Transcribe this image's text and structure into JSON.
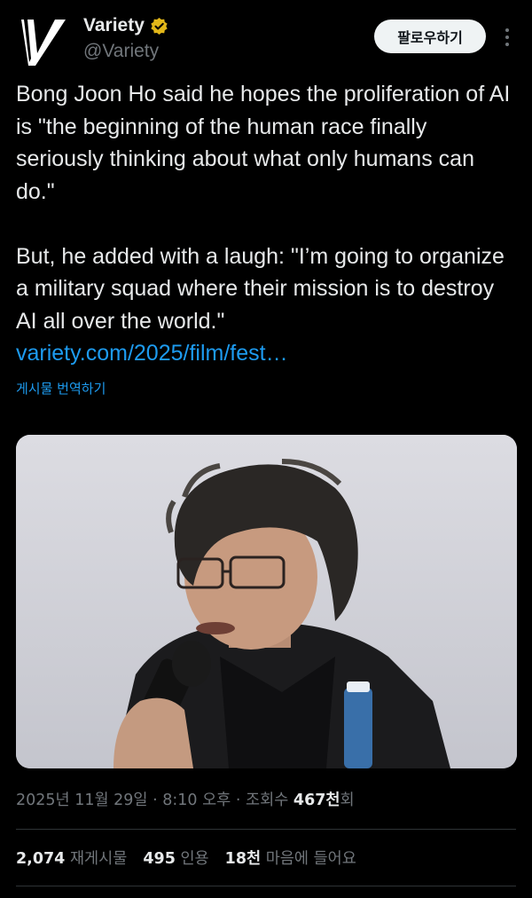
{
  "header": {
    "display_name": "Variety",
    "handle": "@Variety",
    "follow_label": "팔로우하기",
    "logo_letter": "V"
  },
  "tweet": {
    "paragraph1": "Bong Joon Ho said he hopes the proliferation of AI is \"the beginning of the human race finally seriously thinking about what only humans can do.\"",
    "paragraph2": "But, he added with a laugh: \"I’m going to organize a military squad where their mission is to destroy AI all over the world.\"",
    "link": "variety.com/2025/film/fest…",
    "translate_label": "게시물 번역하기"
  },
  "meta": {
    "date": "2025년 11월 29일",
    "time": "8:10 오후",
    "views_label": "조회수",
    "views_count": "467천",
    "views_suffix": "회"
  },
  "stats": {
    "reposts_count": "2,074",
    "reposts_label": "재게시물",
    "quotes_count": "495",
    "quotes_label": "인용",
    "likes_count": "18천",
    "likes_label": "마음에 들어요"
  },
  "colors": {
    "background": "#000000",
    "text": "#e7e9ea",
    "muted": "#71767b",
    "link": "#1d9bf0",
    "verified_badge": "#e2b719"
  }
}
